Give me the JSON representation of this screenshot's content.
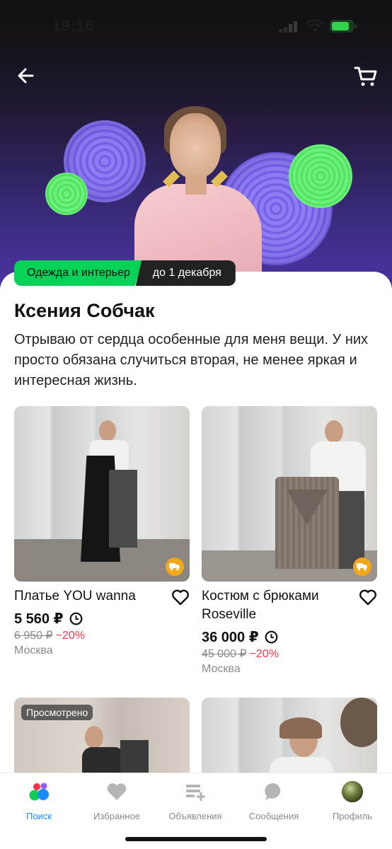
{
  "status_bar": {
    "time": "19:16"
  },
  "header": {
    "back_icon": "arrow-left-icon",
    "cart_icon": "cart-icon"
  },
  "promo": {
    "category_tag": "Одежда и интерьер",
    "date_tag": "до 1 декабря",
    "title": "Ксения Собчак",
    "description": "Отрываю от сердца особенные для меня вещи. У них просто обязана случиться вторая, не менее яркая и интересная жизнь."
  },
  "products": [
    {
      "name": "Платье YOU wanna",
      "price": "5 560 ₽",
      "old_price": "6 950 ₽",
      "discount": "−20%",
      "city": "Москва"
    },
    {
      "name": "Костюм с брюками Roseville",
      "price": "36 000 ₽",
      "old_price": "45 000 ₽",
      "discount": "−20%",
      "city": "Москва"
    },
    {
      "badge": "Просмотрено"
    },
    {}
  ],
  "tabbar": {
    "tabs": [
      {
        "label": "Поиск",
        "active": true
      },
      {
        "label": "Избранное"
      },
      {
        "label": "Объявления"
      },
      {
        "label": "Сообщения"
      },
      {
        "label": "Профиль"
      }
    ]
  },
  "colors": {
    "accent_green": "#08d158",
    "accent_blue": "#1a8cff",
    "discount_red": "#ff3347"
  }
}
